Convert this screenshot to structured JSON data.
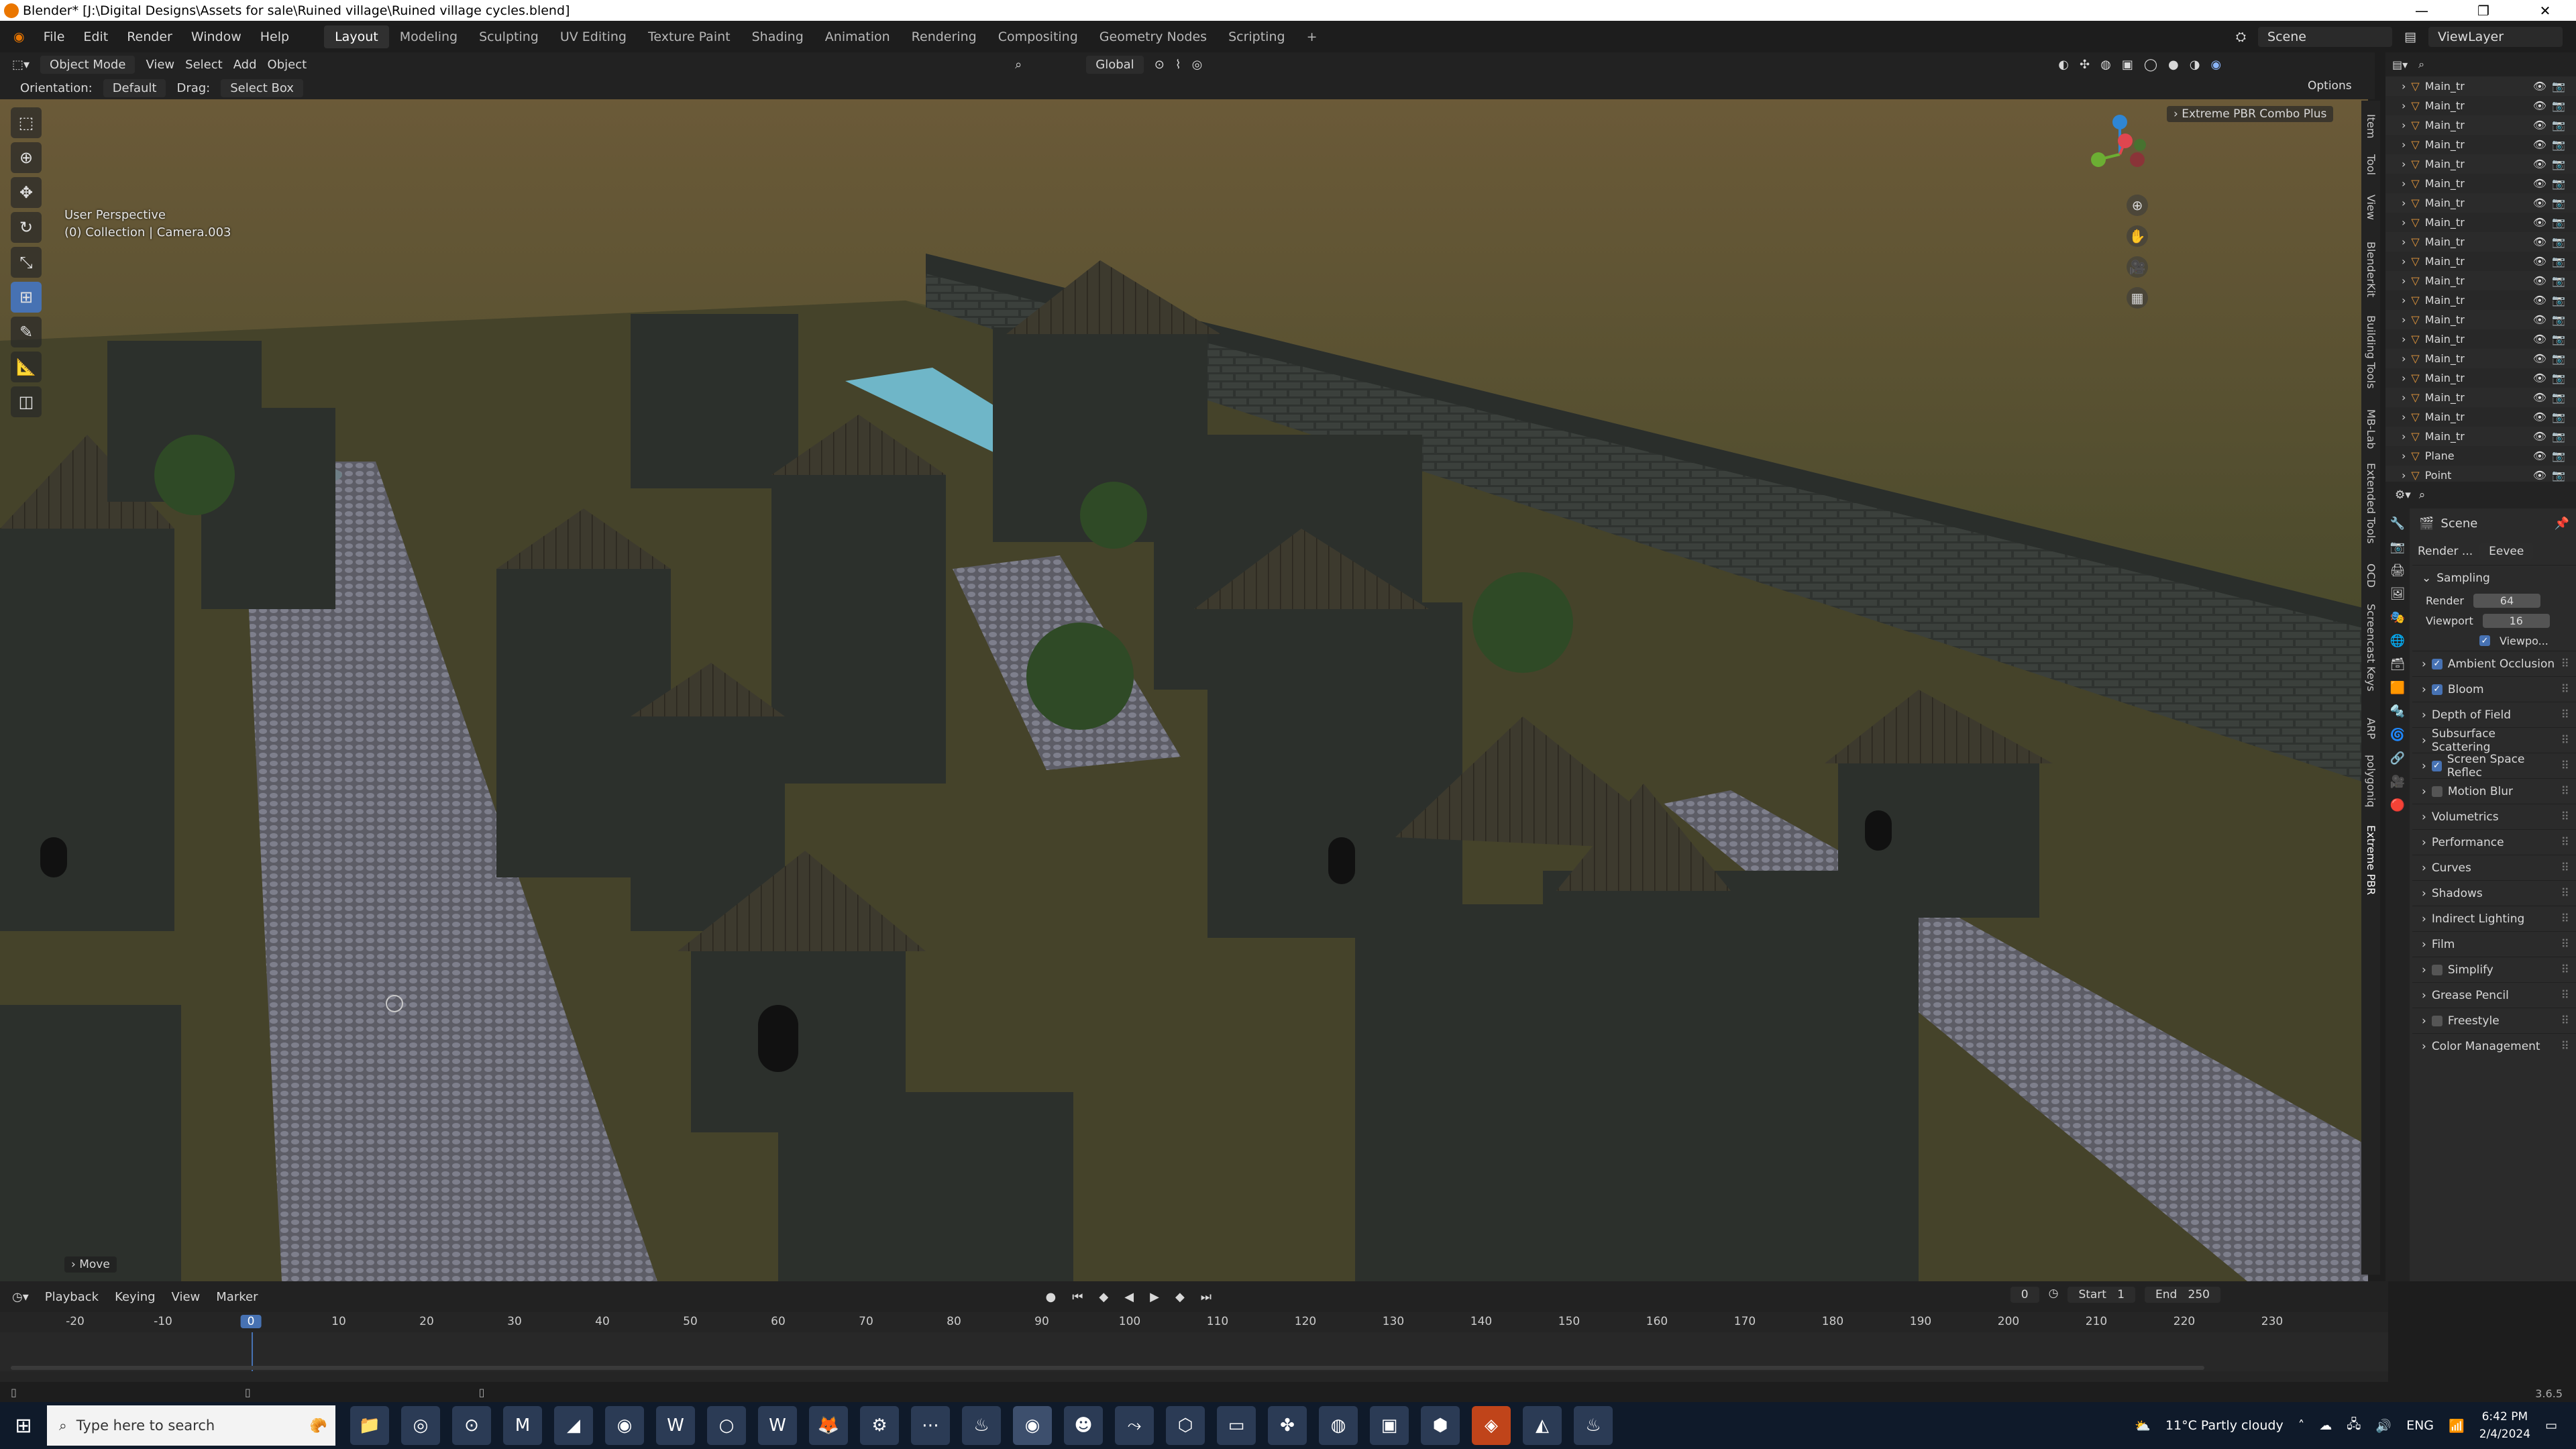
{
  "window": {
    "title": "Blender* [J:\\Digital Designs\\Assets for sale\\Ruined village\\Ruined village cycles.blend]"
  },
  "menu": [
    "File",
    "Edit",
    "Render",
    "Window",
    "Help"
  ],
  "workspaces": [
    "Layout",
    "Modeling",
    "Sculpting",
    "UV Editing",
    "Texture Paint",
    "Shading",
    "Animation",
    "Rendering",
    "Compositing",
    "Geometry Nodes",
    "Scripting"
  ],
  "top_right": {
    "scene": "Scene",
    "view_layer": "ViewLayer"
  },
  "viewport_header": {
    "mode": "Object Mode",
    "menus": [
      "View",
      "Select",
      "Add",
      "Object"
    ],
    "transform": "Global",
    "orientation_label": "Orientation:",
    "orientation": "Default",
    "drag_label": "Drag:",
    "drag": "Select Box",
    "options": "Options"
  },
  "viewport": {
    "perspective": "User Perspective",
    "collection": "(0) Collection | Camera.003",
    "addon_panel": "Extreme PBR Combo Plus",
    "last_op": "Move",
    "side_tabs": [
      "Item",
      "Tool",
      "View",
      "BlenderKit",
      "Building Tools",
      "MB-Lab",
      "Extended Tools",
      "OCD",
      "Screencast Keys",
      "ARP",
      "polygoniq",
      "Extreme PBR"
    ]
  },
  "outliner": {
    "items": [
      "Main_tr",
      "Main_tr",
      "Main_tr",
      "Main_tr",
      "Main_tr",
      "Main_tr",
      "Main_tr",
      "Main_tr",
      "Main_tr",
      "Main_tr",
      "Main_tr",
      "Main_tr",
      "Main_tr",
      "Main_tr",
      "Main_tr",
      "Main_tr",
      "Main_tr",
      "Main_tr",
      "Main_tr",
      "Plane",
      "Point"
    ]
  },
  "properties": {
    "scene": "Scene",
    "render_engine_label": "Render ...",
    "render_engine": "Eevee",
    "sampling": {
      "label": "Sampling",
      "render_label": "Render",
      "render": "64",
      "viewport_label": "Viewport",
      "viewport": "16",
      "denoise": "Viewpo..."
    },
    "sections": [
      {
        "name": "Ambient Occlusion",
        "check": true
      },
      {
        "name": "Bloom",
        "check": true
      },
      {
        "name": "Depth of Field",
        "check": null
      },
      {
        "name": "Subsurface Scattering",
        "check": null
      },
      {
        "name": "Screen Space Reflec",
        "check": true
      },
      {
        "name": "Motion Blur",
        "check": false
      },
      {
        "name": "Volumetrics",
        "check": null
      },
      {
        "name": "Performance",
        "check": null
      },
      {
        "name": "Curves",
        "check": null
      },
      {
        "name": "Shadows",
        "check": null
      },
      {
        "name": "Indirect Lighting",
        "check": null
      },
      {
        "name": "Film",
        "check": null
      },
      {
        "name": "Simplify",
        "check": false
      },
      {
        "name": "Grease Pencil",
        "check": null
      },
      {
        "name": "Freestyle",
        "check": false
      },
      {
        "name": "Color Management",
        "check": null
      }
    ]
  },
  "timeline": {
    "menus": [
      "Playback",
      "Keying",
      "View",
      "Marker"
    ],
    "current": "0",
    "start_label": "Start",
    "start": "1",
    "end_label": "End",
    "end": "250",
    "ruler": [
      "-20",
      "-10",
      "0",
      "10",
      "20",
      "30",
      "40",
      "50",
      "60",
      "70",
      "80",
      "90",
      "100",
      "110",
      "120",
      "130",
      "140",
      "150",
      "160",
      "170",
      "180",
      "190",
      "200",
      "210",
      "220",
      "230"
    ]
  },
  "version": "3.6.5",
  "taskbar": {
    "search_placeholder": "Type here to search",
    "weather": "11°C  Partly cloudy",
    "lang": "ENG",
    "time": "6:42 PM",
    "date": "2/4/2024"
  }
}
